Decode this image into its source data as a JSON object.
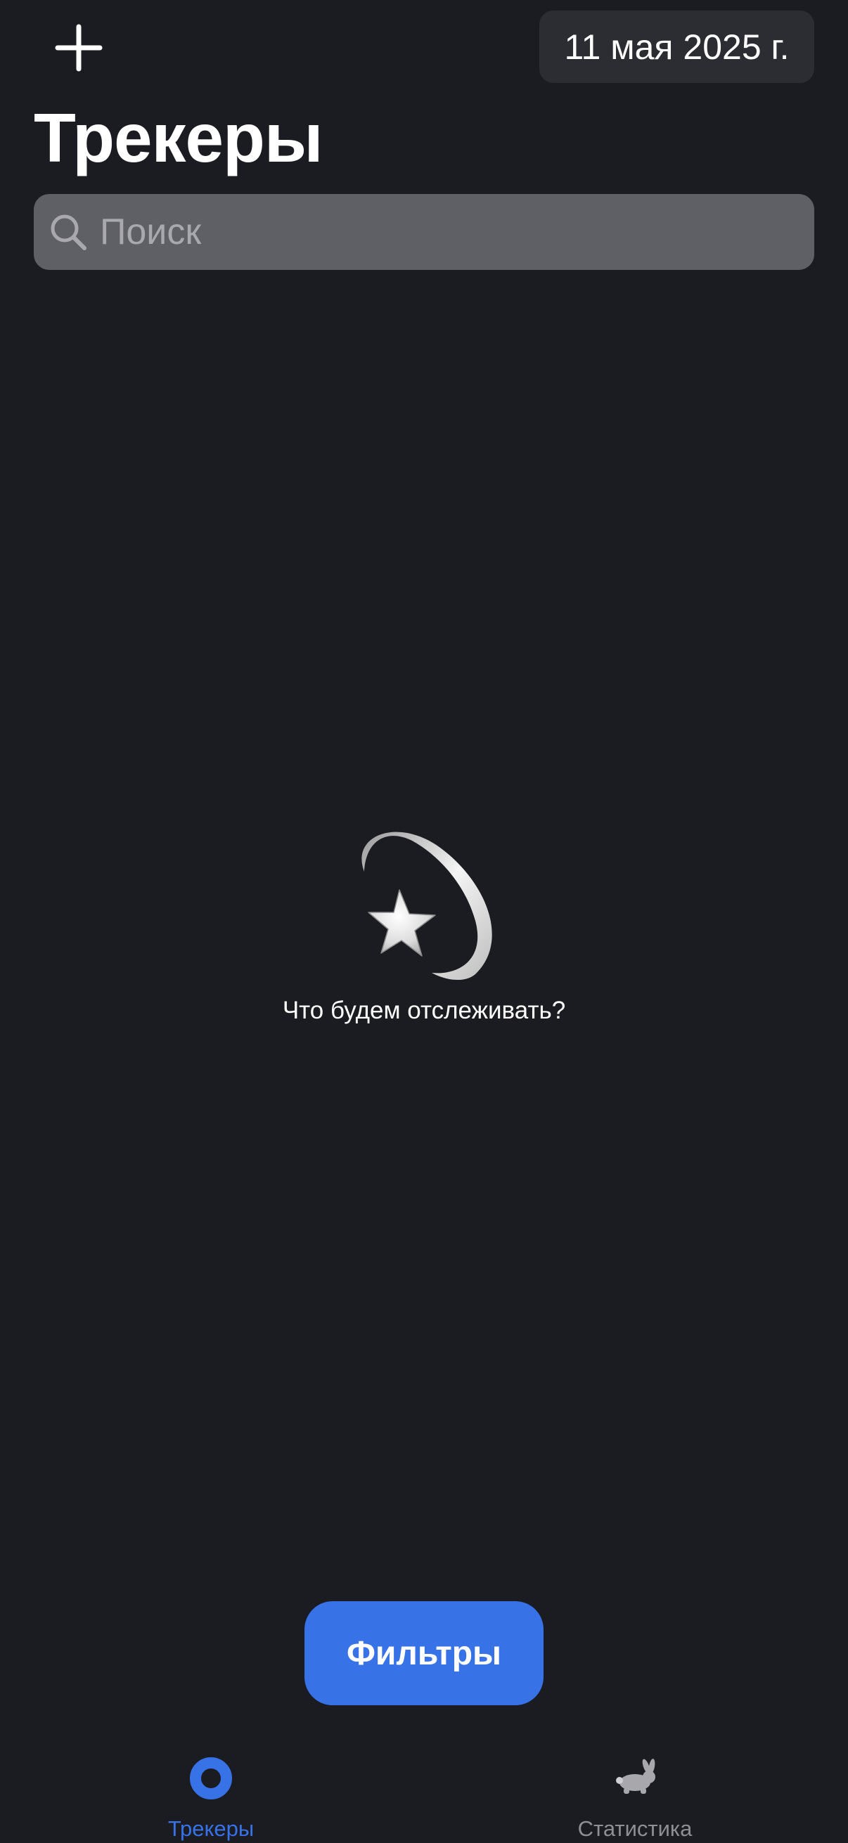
{
  "header": {
    "add_icon": "plus-icon",
    "date": "11 мая 2025 г."
  },
  "page": {
    "title": "Трекеры"
  },
  "search": {
    "placeholder": "Поиск",
    "value": "",
    "icon": "magnifier-icon"
  },
  "empty_state": {
    "icon": "dizzy-star-icon",
    "text": "Что будем отслеживать?"
  },
  "filters": {
    "label": "Фильтры"
  },
  "tab_bar": {
    "tabs": [
      {
        "label": "Трекеры",
        "icon": "trackers-ring-icon",
        "active": true,
        "color": "#3772e7"
      },
      {
        "label": "Статистика",
        "icon": "rabbit-icon",
        "active": false,
        "color": "#8e8e93"
      }
    ]
  },
  "colors": {
    "background": "#1b1b22",
    "accent": "#3772e7",
    "search_field": "#5f6066",
    "date_chip": "#2c2c33"
  }
}
